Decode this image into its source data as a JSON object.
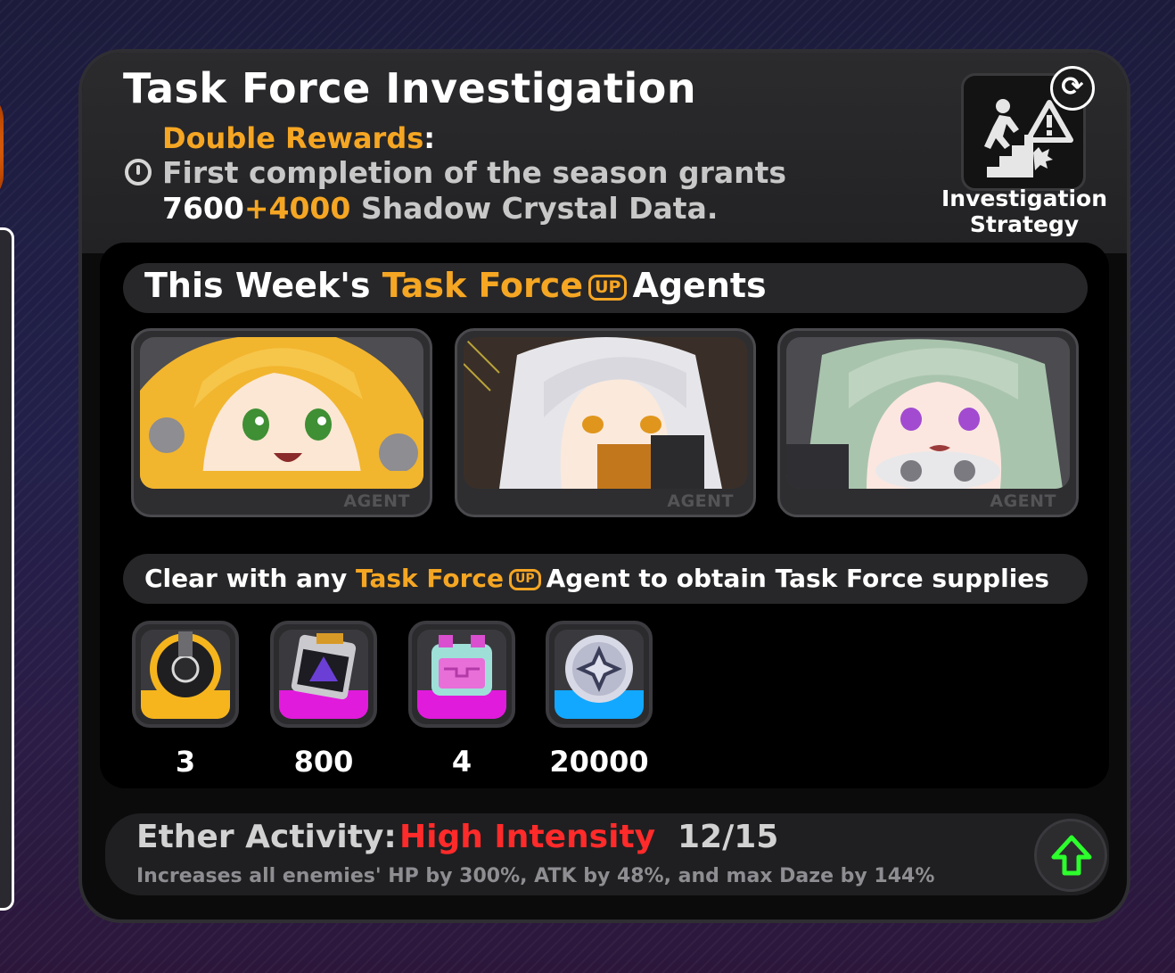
{
  "header": {
    "title": "Task Force Investigation",
    "double_rewards_label": "Double Rewards",
    "colon": ":",
    "desc_line1": "First completion of the season grants",
    "base_amount": "7600",
    "bonus_amount": "+4000",
    "reward_name": "Shadow Crystal Data."
  },
  "strategy": {
    "label": "Investigation Strategy",
    "refresh_icon": "⟳"
  },
  "agents_section": {
    "prefix": "This Week's",
    "highlight": "Task Force",
    "badge": "UP",
    "suffix": "Agents",
    "agents": [
      {
        "tag": "AGENT",
        "hair_color": "#f2b52e"
      },
      {
        "tag": "AGENT",
        "hair_color": "#e6e6ea"
      },
      {
        "tag": "AGENT",
        "hair_color": "#a9c4ad"
      }
    ]
  },
  "supplies_section": {
    "prefix": "Clear with any",
    "highlight": "Task Force",
    "badge": "UP",
    "suffix": "Agent to obtain Task Force supplies",
    "items": [
      {
        "quantity": "3",
        "rarity_color": "#f6b51d",
        "icon": "bangboo-core-icon"
      },
      {
        "quantity": "800",
        "rarity_color": "#e11bdc",
        "icon": "data-chip-icon"
      },
      {
        "quantity": "4",
        "rarity_color": "#e11bdc",
        "icon": "material-pack-icon"
      },
      {
        "quantity": "20000",
        "rarity_color": "#12a8ff",
        "icon": "dennies-coin-icon"
      }
    ]
  },
  "ether": {
    "label": "Ether Activity:",
    "level": "High Intensity",
    "count": "12/15",
    "description": "Increases all enemies' HP by 300%, ATK by 48%, and max Daze by 144%"
  },
  "colors": {
    "accent": "#f5a623",
    "danger": "#ff2a2a",
    "upgrade": "#2cff2c"
  }
}
